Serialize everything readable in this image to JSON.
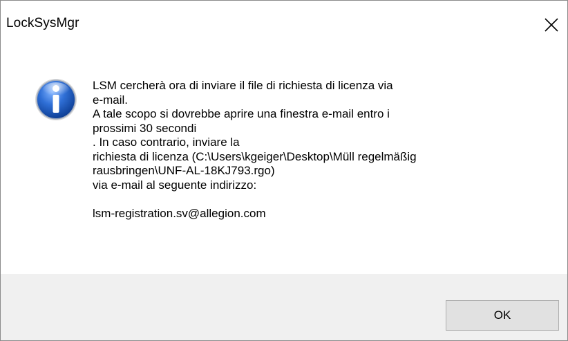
{
  "window": {
    "title": "LockSysMgr",
    "close_icon": "close-icon"
  },
  "message": {
    "icon": "info-icon",
    "lines": [
      "LSM cercherà ora di inviare il file di richiesta di licenza via",
      "e-mail.",
      "A tale scopo si dovrebbe aprire una finestra e-mail entro i",
      "prossimi 30 secondi",
      ". In caso contrario, inviare la",
      "richiesta di licenza (C:\\Users\\kgeiger\\Desktop\\Müll regelmäßig",
      "rausbringen\\UNF-AL-18KJ793.rgo)",
      "via e-mail al seguente indirizzo:",
      "",
      "lsm-registration.sv@allegion.com"
    ]
  },
  "buttons": {
    "ok_label": "OK"
  },
  "colors": {
    "footer_bg": "#f0f0f0",
    "button_bg": "#e1e1e1",
    "icon_blue": "#1f5fbf"
  }
}
